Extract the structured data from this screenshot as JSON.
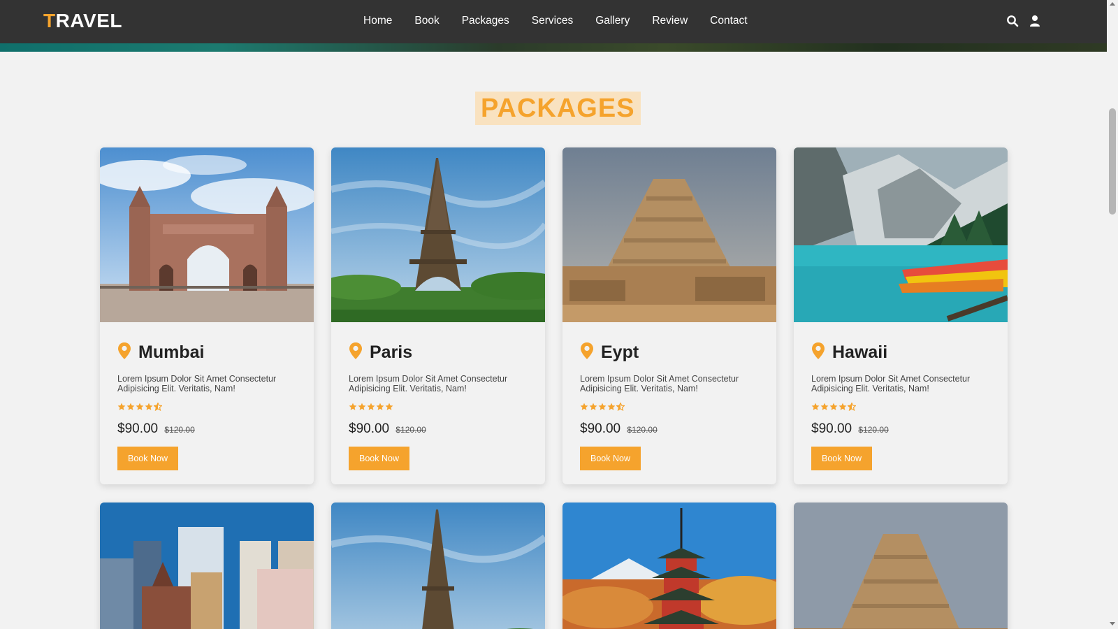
{
  "header": {
    "logo_first": "T",
    "logo_rest": "RAVEL",
    "nav": [
      "Home",
      "Book",
      "Packages",
      "Services",
      "Gallery",
      "Review",
      "Contact"
    ],
    "icons": [
      "search-icon",
      "user-icon"
    ]
  },
  "section": {
    "title": "PACKAGES"
  },
  "colors": {
    "accent": "#f5a32d",
    "header_bg": "#333333",
    "page_bg": "#f2f2f2"
  },
  "packages": [
    {
      "name": "Mumbai",
      "desc": "Lorem Ipsum Dolor Sit Amet Consectetur Adipisicing Elit. Veritatis, Nam!",
      "rating": 4.5,
      "price": "$90.00",
      "old_price": "$120.00",
      "button": "Book Now"
    },
    {
      "name": "Paris",
      "desc": "Lorem Ipsum Dolor Sit Amet Consectetur Adipisicing Elit. Veritatis, Nam!",
      "rating": 5,
      "price": "$90.00",
      "old_price": "$120.00",
      "button": "Book Now"
    },
    {
      "name": "Eypt",
      "desc": "Lorem Ipsum Dolor Sit Amet Consectetur Adipisicing Elit. Veritatis, Nam!",
      "rating": 4.5,
      "price": "$90.00",
      "old_price": "$120.00",
      "button": "Book Now"
    },
    {
      "name": "Hawaii",
      "desc": "Lorem Ipsum Dolor Sit Amet Consectetur Adipisicing Elit. Veritatis, Nam!",
      "rating": 4.5,
      "price": "$90.00",
      "old_price": "$120.00",
      "button": "Book Now"
    }
  ]
}
